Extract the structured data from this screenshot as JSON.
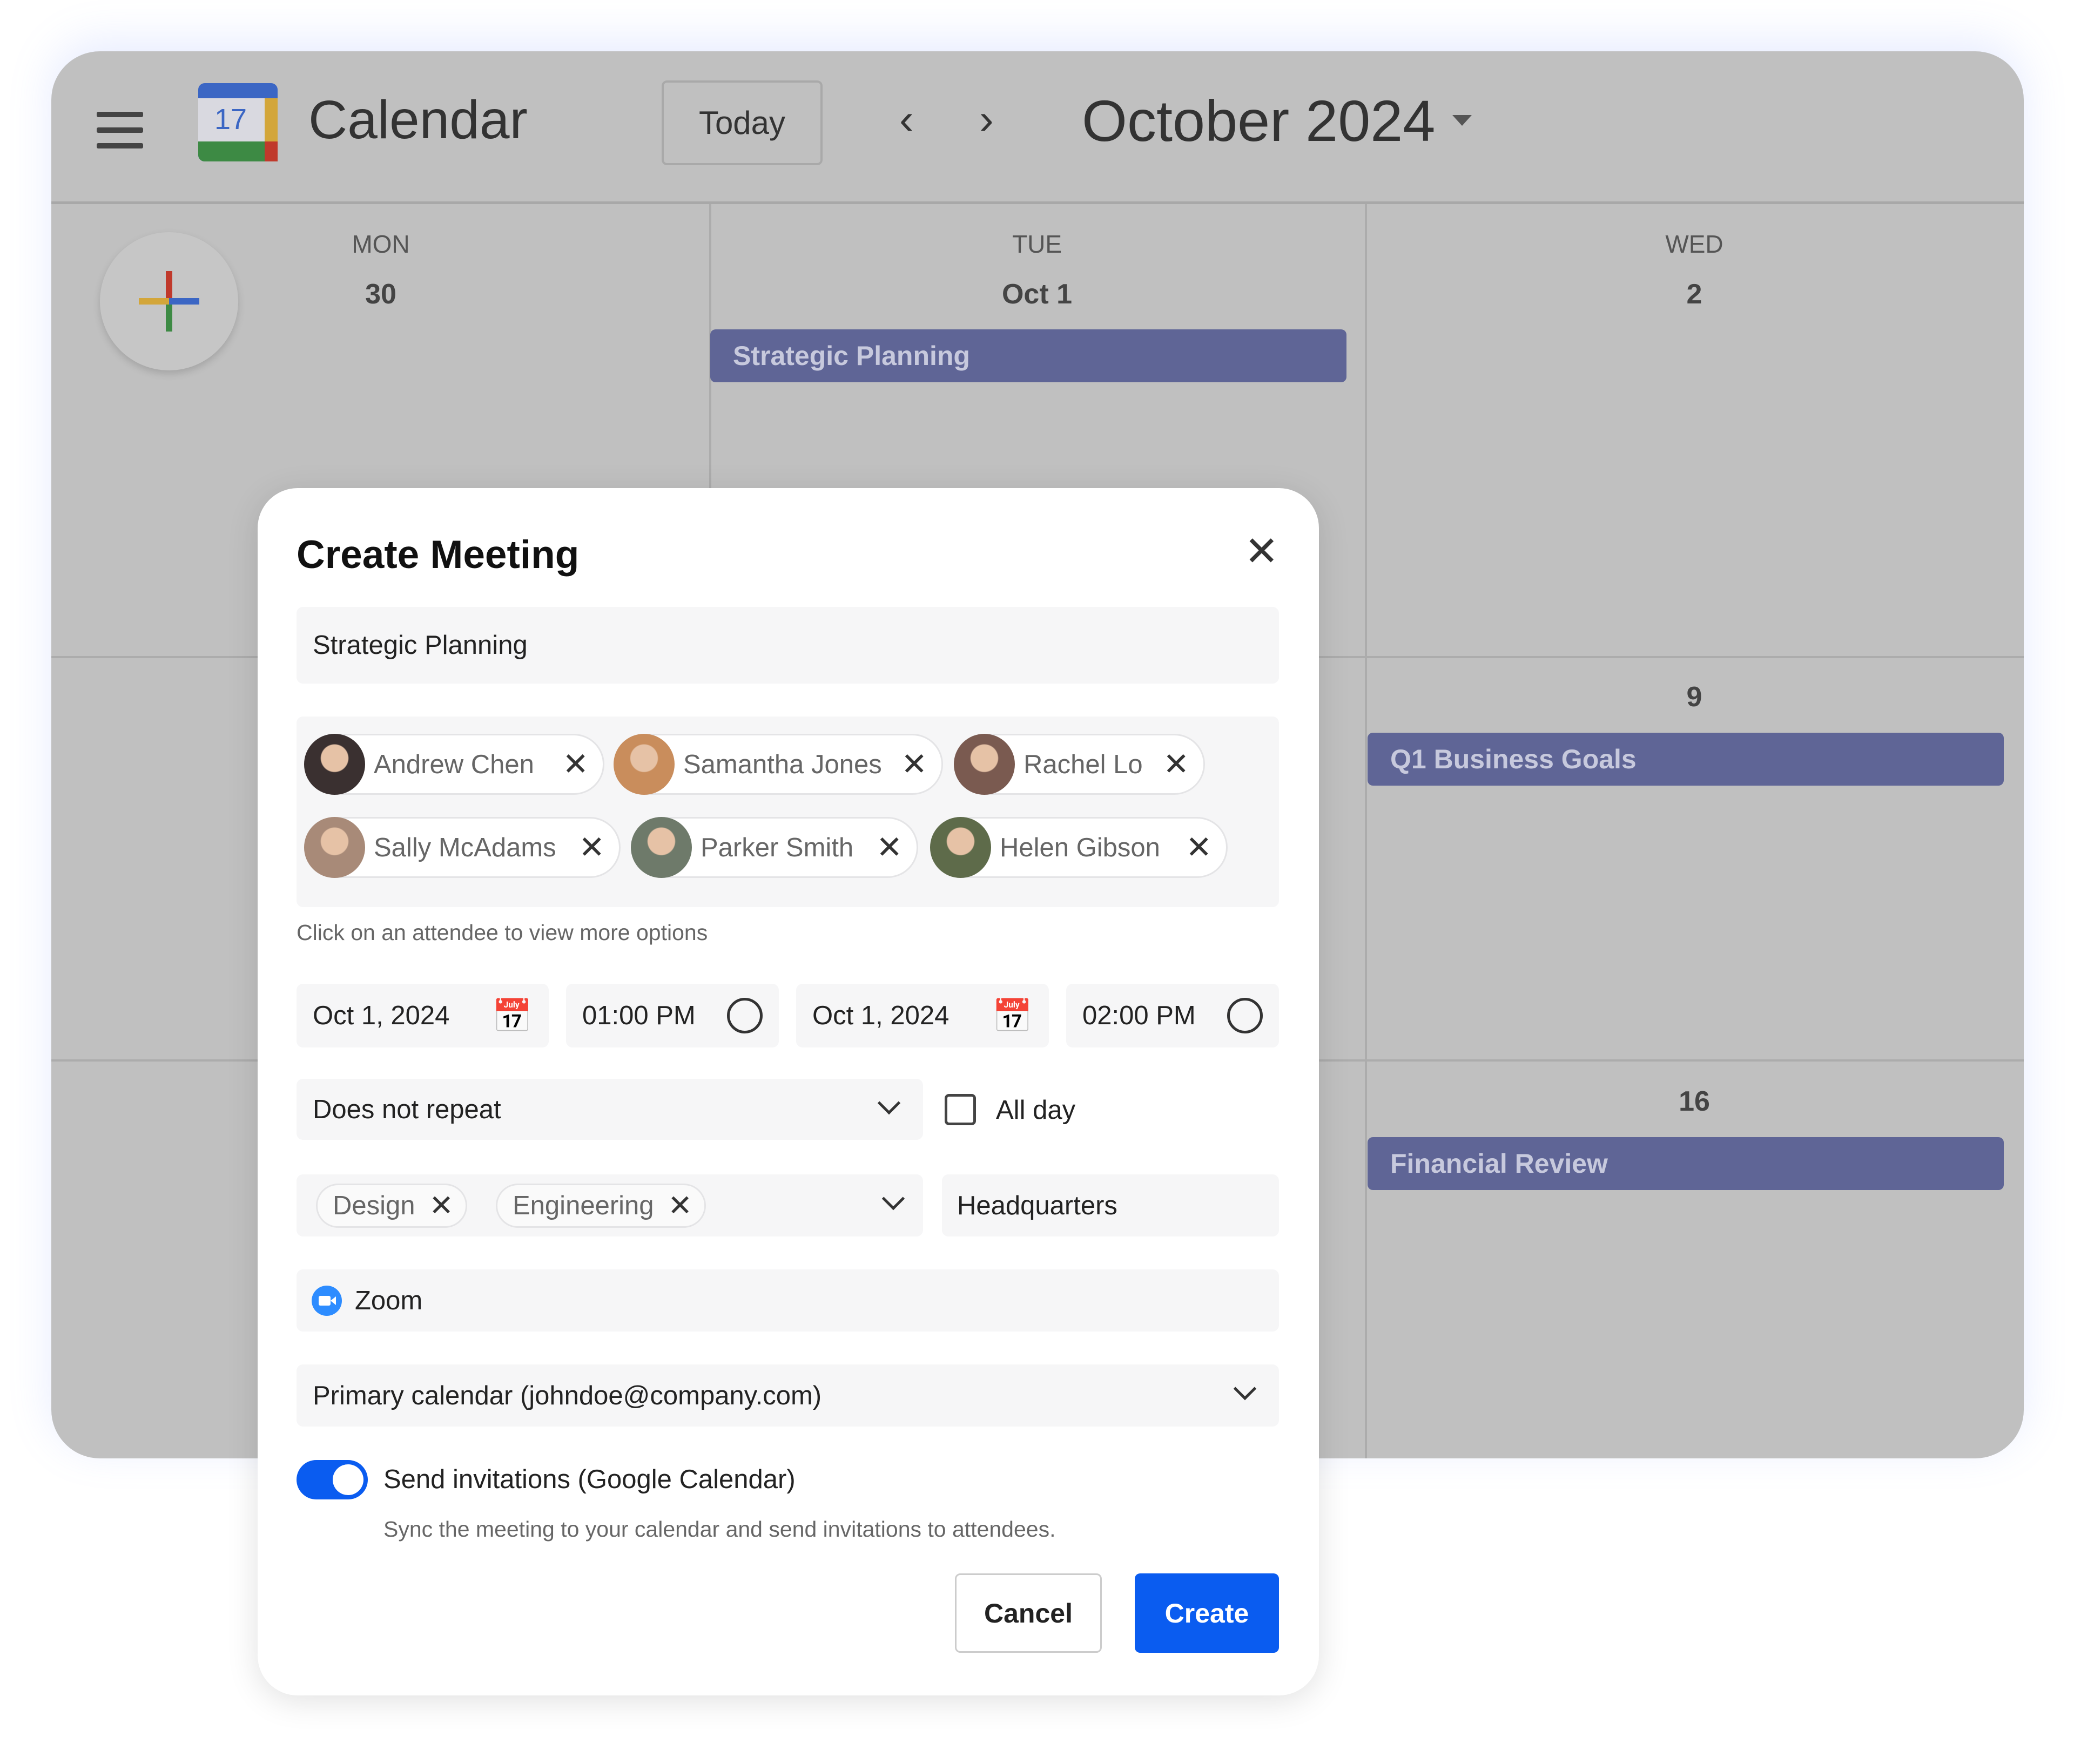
{
  "header": {
    "app_title": "Calendar",
    "logo_day": "17",
    "today_label": "Today",
    "month_label": "October 2024"
  },
  "days": [
    {
      "name": "MON",
      "num": "30"
    },
    {
      "name": "TUE",
      "num": "Oct 1"
    },
    {
      "name": "WED",
      "num": "2"
    }
  ],
  "week_numbers": {
    "row2": "9",
    "row3": "16"
  },
  "events": [
    "Strategic Planning",
    "Q1 Business Goals",
    "Financial Review"
  ],
  "modal": {
    "title": "Create Meeting",
    "meeting_title": "Strategic Planning",
    "attendees": [
      {
        "name": "Andrew Chen",
        "color": "#3a3030"
      },
      {
        "name": "Samantha Jones",
        "color": "#c98d5c"
      },
      {
        "name": "Rachel Lo",
        "color": "#7a5a50"
      },
      {
        "name": "Sally McAdams",
        "color": "#a88a78"
      },
      {
        "name": "Parker Smith",
        "color": "#6e7a6a"
      },
      {
        "name": "Helen Gibson",
        "color": "#5e6b4a"
      }
    ],
    "attendee_hint": "Click on an attendee to view more options",
    "start_date": "Oct 1, 2024",
    "start_time": "01:00 PM",
    "end_date": "Oct 1, 2024",
    "end_time": "02:00 PM",
    "repeat": "Does not repeat",
    "all_day_label": "All day",
    "all_day_checked": false,
    "tags": [
      "Design",
      "Engineering"
    ],
    "location": "Headquarters",
    "conference": "Zoom",
    "calendar": "Primary calendar (johndoe@company.com)",
    "send_invitations_label": "Send invitations (Google Calendar)",
    "send_invitations_on": true,
    "send_invitations_hint": "Sync the meeting to your calendar and send invitations to attendees.",
    "cancel_label": "Cancel",
    "create_label": "Create"
  },
  "colors": {
    "accent": "#0a5cf0",
    "event": "#5f6596"
  }
}
